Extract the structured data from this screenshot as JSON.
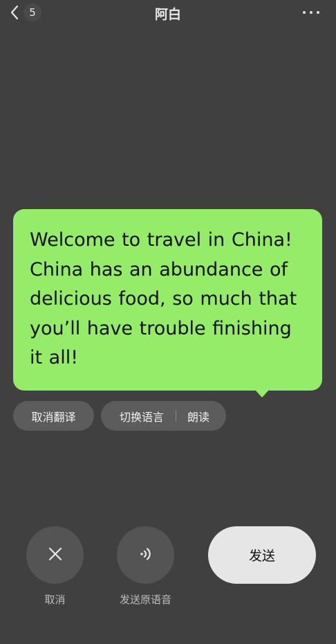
{
  "header": {
    "back_count": "5",
    "title": "阿白",
    "icons": {
      "back": "chevron-left-icon",
      "more": "more-horizontal-icon"
    }
  },
  "bubble": {
    "text": "Welcome to travel in China! China has an abundance of delicious food, so much that you’ll have trouble finishing it all!",
    "color": "#95ec69"
  },
  "actions": {
    "cancel_translate": "取消翻译",
    "switch_language": "切换语言",
    "read_aloud": "朗读"
  },
  "bottom": {
    "cancel_label": "取消",
    "send_original_voice_label": "发送原语音",
    "send_label": "发送",
    "icons": {
      "cancel": "close-icon",
      "voice": "sound-wave-icon"
    }
  },
  "colors": {
    "background": "#404040",
    "bubble": "#95ec69",
    "send_button": "#e6e6e6"
  }
}
